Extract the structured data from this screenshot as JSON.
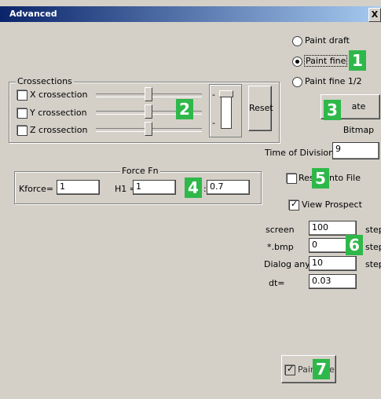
{
  "window": {
    "title": "Advanced",
    "close_glyph": "X"
  },
  "paint_mode": {
    "options": [
      "Paint draft",
      "Paint fine",
      "Paint fine 1/2"
    ],
    "selected": "Paint fine"
  },
  "crossections": {
    "legend": "Crossections",
    "items": [
      {
        "label": "X crossection",
        "checked": false
      },
      {
        "label": "Y crossection",
        "checked": false
      },
      {
        "label": "Z crossection",
        "checked": false
      }
    ],
    "mini_labels": [
      "-",
      "-"
    ],
    "reset_label": "Reset"
  },
  "create_bitmap": {
    "label": "ate Bitmap"
  },
  "time_of_division": {
    "label": "Time of Division",
    "value": "9"
  },
  "force": {
    "legend": "Force Fn",
    "kforce_label": "Kforce=",
    "kforce_value": "1",
    "h1_label": "H1 =",
    "h1_value": "1",
    "third_label": ":",
    "third_value": "0.7"
  },
  "result_into_file": {
    "label_a": "Res",
    "label_b": "into File",
    "checked": false
  },
  "view_prospect": {
    "label": "View Prospect",
    "checked": true
  },
  "steps": [
    {
      "label": "screen",
      "value": "100",
      "unit": "step"
    },
    {
      "label": "*.bmp",
      "value": "0",
      "unit": "step"
    },
    {
      "label": "Dialog any",
      "value": "10",
      "unit": "step"
    },
    {
      "label": "dt=",
      "value": "0.03",
      "unit": ""
    }
  ],
  "paint_button": {
    "label_a": "Pair",
    "label_b": "e",
    "checked": true
  },
  "badges": [
    "1",
    "2",
    "3",
    "4",
    "5",
    "6",
    "7"
  ],
  "colors": {
    "title_start": "#0a246a",
    "title_end": "#a6caf0",
    "face": "#d4d0c8",
    "badge": "#2fb84a"
  }
}
